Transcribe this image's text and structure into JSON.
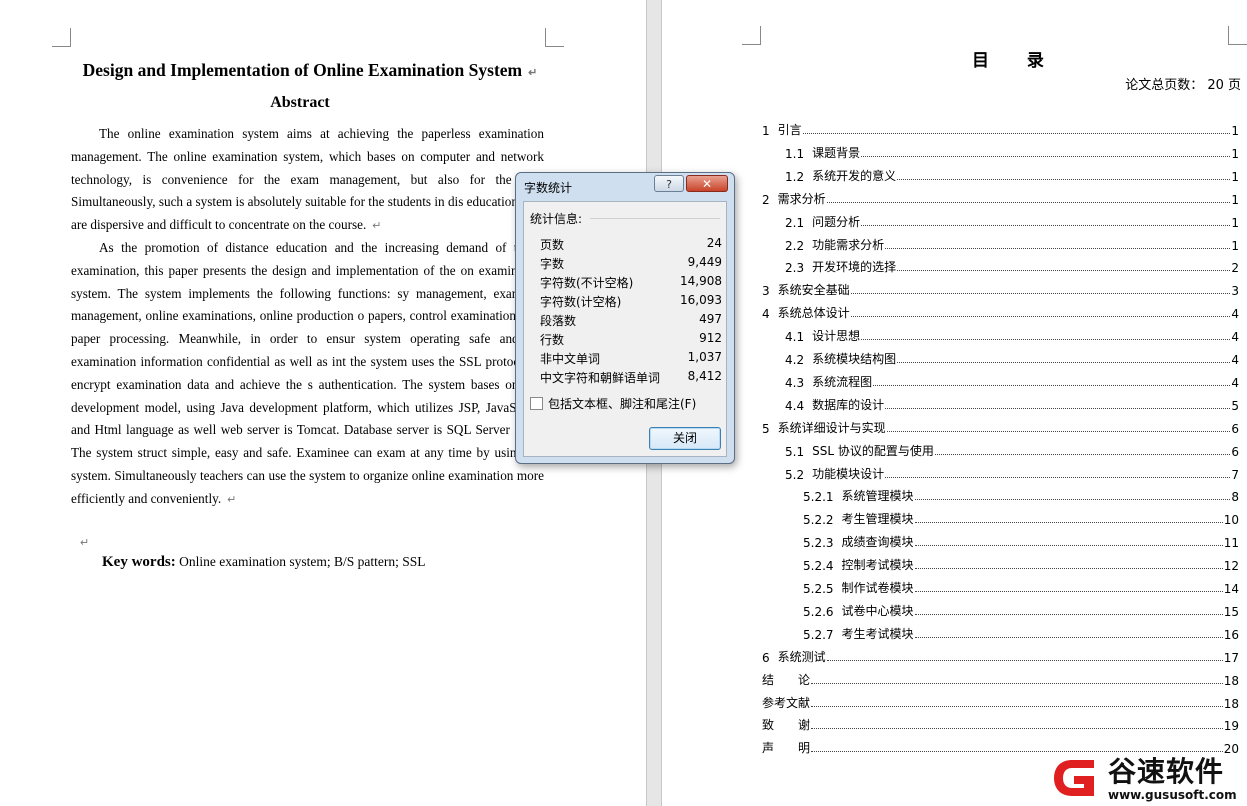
{
  "left_page": {
    "title": "Design and Implementation of Online Examination System",
    "abstract_heading": "Abstract",
    "paragraphs": [
      "The online examination system aims at achieving the paperless examination management. The online examination system, which bases on computer and network technology, is convenience for the exam management, but also for the stud Simultaneously, such a system is absolutely suitable for the students in dis education who are dispersive and difficult to concentrate on the course.",
      "As the promotion of distance education and the increasing demand of the o examination, this paper presents the design and implementation of the on examination system. The system implements the following functions: sy management, examinee management, online examinations, online production o papers, control examinations and paper processing. Meanwhile, in order to ensur system operating safe and the examination information confidential as well as int the system uses the SSL protocol to encrypt examination data and achieve the s authentication. The system bases on B/S development model, using Java development platform, which utilizes JSP, JavaScript, and Html language as well web server is Tomcat. Database server is SQL Server 2000. The system struct simple, easy and safe. Examinee can exam at any time by using the system. Simultaneously teachers can use the system to organize online examination more efficiently and conveniently."
    ],
    "keywords_label": "Key words:",
    "keywords_text": "Online examination system; B/S pattern; SSL",
    "para_mark": "↵"
  },
  "right_page": {
    "toc_title": "目 录",
    "total_pages": "论文总页数： 20 页",
    "toc": [
      {
        "num": "1",
        "label": "引言",
        "page": "1"
      },
      {
        "num": "1.1",
        "label": "课题背景",
        "page": "1"
      },
      {
        "num": "1.2",
        "label": "系统开发的意义",
        "page": "1"
      },
      {
        "num": "2",
        "label": "需求分析",
        "page": "1"
      },
      {
        "num": "2.1",
        "label": "问题分析",
        "page": "1"
      },
      {
        "num": "2.2",
        "label": "功能需求分析",
        "page": "1"
      },
      {
        "num": "2.3",
        "label": "开发环境的选择",
        "page": "2"
      },
      {
        "num": "3",
        "label": "系统安全基础",
        "page": "3"
      },
      {
        "num": "4",
        "label": "系统总体设计",
        "page": "4"
      },
      {
        "num": "4.1",
        "label": "设计思想",
        "page": "4"
      },
      {
        "num": "4.2",
        "label": "系统模块结构图",
        "page": "4"
      },
      {
        "num": "4.3",
        "label": "系统流程图",
        "page": "4"
      },
      {
        "num": "4.4",
        "label": "数据库的设计",
        "page": "5"
      },
      {
        "num": "5",
        "label": "系统详细设计与实现",
        "page": "6"
      },
      {
        "num": "5.1",
        "label": "SSL 协议的配置与使用",
        "page": "6"
      },
      {
        "num": "5.2",
        "label": "功能模块设计",
        "page": "7"
      },
      {
        "num": "5.2.1",
        "label": "系统管理模块",
        "page": "8"
      },
      {
        "num": "5.2.2",
        "label": "考生管理模块",
        "page": "10"
      },
      {
        "num": "5.2.3",
        "label": "成绩查询模块",
        "page": "11"
      },
      {
        "num": "5.2.4",
        "label": "控制考试模块",
        "page": "12"
      },
      {
        "num": "5.2.5",
        "label": "制作试卷模块",
        "page": "14"
      },
      {
        "num": "5.2.6",
        "label": "试卷中心模块",
        "page": "15"
      },
      {
        "num": "5.2.7",
        "label": "考生考试模块",
        "page": "16"
      },
      {
        "num": "6",
        "label": "系统测试",
        "page": "17"
      },
      {
        "num": "",
        "label": "结　　论",
        "page": "18"
      },
      {
        "num": "",
        "label": "参考文献",
        "page": "18"
      },
      {
        "num": "",
        "label": "致　　谢",
        "page": "19"
      },
      {
        "num": "",
        "label": "声　　明",
        "page": "20"
      }
    ]
  },
  "dialog": {
    "title": "字数统计",
    "help_label": "?",
    "close_x": "✕",
    "section_label": "统计信息:",
    "stats": [
      {
        "label": "页数",
        "value": "24"
      },
      {
        "label": "字数",
        "value": "9,449"
      },
      {
        "label": "字符数(不计空格)",
        "value": "14,908"
      },
      {
        "label": "字符数(计空格)",
        "value": "16,093"
      },
      {
        "label": "段落数",
        "value": "497"
      },
      {
        "label": "行数",
        "value": "912"
      },
      {
        "label": "非中文单词",
        "value": "1,037"
      },
      {
        "label": "中文字符和朝鲜语单词",
        "value": "8,412"
      }
    ],
    "checkbox_label": "包括文本框、脚注和尾注(F)",
    "checkbox_checked": false,
    "close_button": "关闭"
  },
  "watermark": {
    "name": "谷速软件",
    "url": "www.gususoft.com",
    "colors": {
      "red": "#e02020",
      "dark": "#111111"
    }
  }
}
